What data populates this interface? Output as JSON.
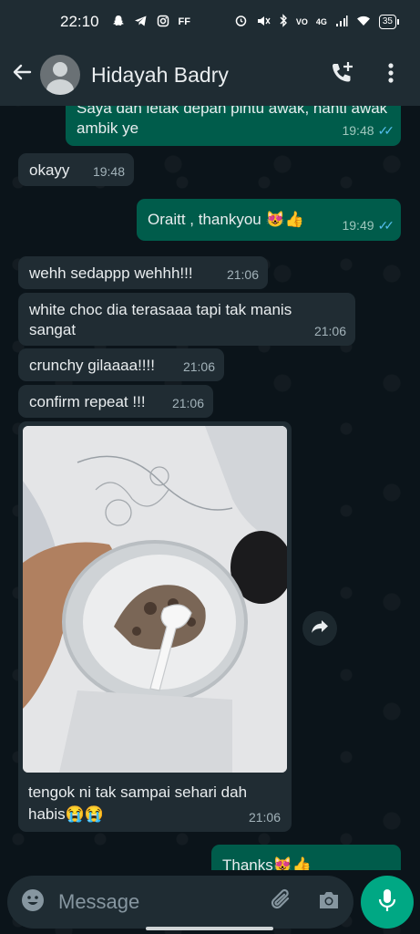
{
  "status_bar": {
    "time": "22:10",
    "left_icons": [
      "snapchat-icon",
      "telegram-icon",
      "instagram-icon",
      "ff-icon"
    ],
    "ff_label": "FF",
    "right_icons": [
      "alarm-icon",
      "mute-icon",
      "bluetooth-icon",
      "volte-icon",
      "signal-icon",
      "wifi-icon"
    ],
    "network_label": "4G",
    "battery": "35"
  },
  "header": {
    "back_icon": "arrow-left-icon",
    "contact_name": "Hidayah Badry",
    "call_icon": "add-call-icon",
    "menu_icon": "more-vertical-icon"
  },
  "messages": [
    {
      "dir": "out",
      "text": "Saya dah letak depan pintu awak, nanti awak ambik ye",
      "time": "19:48",
      "read": true
    },
    {
      "dir": "in",
      "text": "okayy",
      "time": "19:48"
    },
    {
      "dir": "out",
      "text": "Oraitt , thankyou 😻👍",
      "time": "19:49",
      "read": true
    },
    {
      "dir": "in",
      "text": "wehh sedappp wehhh!!!",
      "time": "21:06"
    },
    {
      "dir": "in",
      "text": "white choc dia terasaaa tapi tak manis sangat",
      "time": "21:06"
    },
    {
      "dir": "in",
      "text": "crunchy gilaaaa!!!!",
      "time": "21:06"
    },
    {
      "dir": "in",
      "text": "confirm repeat !!!",
      "time": "21:06"
    },
    {
      "dir": "in",
      "type": "image",
      "caption": "tengok ni tak sampai sehari dah habis😭😭",
      "time": "21:06"
    },
    {
      "dir": "out",
      "text": "Thanks😻👍",
      "time": ""
    }
  ],
  "input": {
    "emoji_icon": "emoji-icon",
    "placeholder": "Message",
    "attach_icon": "paperclip-icon",
    "camera_icon": "camera-icon",
    "mic_icon": "mic-icon"
  },
  "colors": {
    "background": "#0b141a",
    "bar": "#1f2c33",
    "incoming": "#202c33",
    "outgoing": "#005c4b",
    "accent": "#00a884",
    "read_ticks": "#53bdeb"
  }
}
